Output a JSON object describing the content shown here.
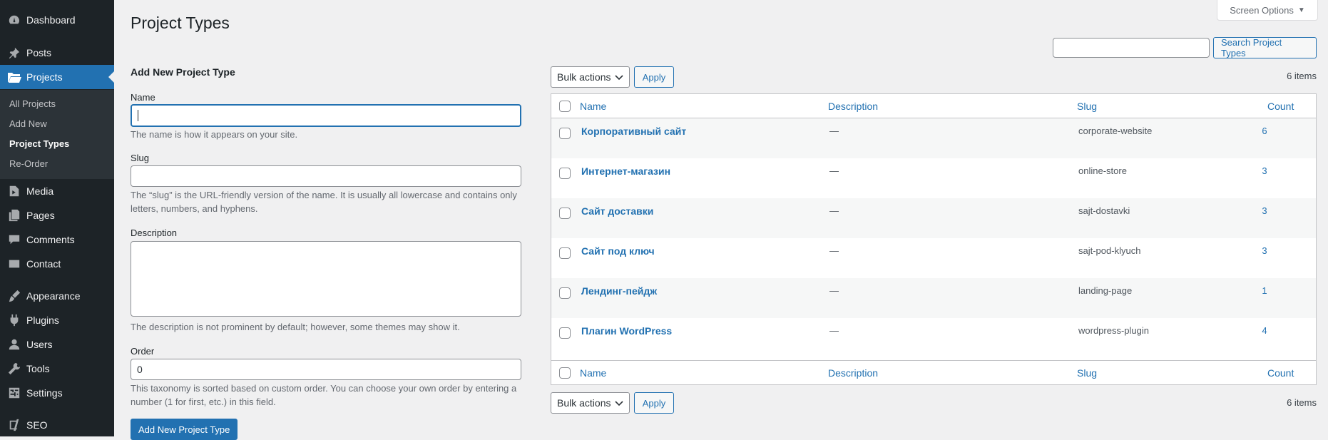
{
  "sidebar": {
    "menu": [
      {
        "label": "Dashboard",
        "icon": "dashboard-icon"
      },
      {
        "label": "Posts",
        "icon": "pin-icon"
      },
      {
        "label": "Projects",
        "icon": "folder-icon"
      },
      {
        "label": "Media",
        "icon": "media-icon"
      },
      {
        "label": "Pages",
        "icon": "pages-icon"
      },
      {
        "label": "Comments",
        "icon": "comment-icon"
      },
      {
        "label": "Contact",
        "icon": "mail-icon"
      },
      {
        "label": "Appearance",
        "icon": "brush-icon"
      },
      {
        "label": "Plugins",
        "icon": "plugin-icon"
      },
      {
        "label": "Users",
        "icon": "user-icon"
      },
      {
        "label": "Tools",
        "icon": "wrench-icon"
      },
      {
        "label": "Settings",
        "icon": "settings-icon"
      },
      {
        "label": "SEO",
        "icon": "seo-icon"
      }
    ],
    "submenu": [
      "All Projects",
      "Add New",
      "Project Types",
      "Re-Order"
    ]
  },
  "header": {
    "title": "Project Types",
    "screen_options": "Screen Options",
    "search_button": "Search Project Types",
    "search_value": ""
  },
  "form": {
    "heading": "Add New Project Type",
    "name_label": "Name",
    "name_value": "",
    "name_desc": "The name is how it appears on your site.",
    "slug_label": "Slug",
    "slug_value": "",
    "slug_desc_1": "The “slug” is the URL-friendly version of the name. It is usually all lowercase and contains only",
    "slug_desc_2": "letters, numbers, and hyphens.",
    "description_label": "Description",
    "description_value": "",
    "description_desc": "The description is not prominent by default; however, some themes may show it.",
    "order_label": "Order",
    "order_value": "0",
    "order_desc_1": "This taxonomy is sorted based on custom order. You can choose your own order by entering a",
    "order_desc_2": "number (1 for first, etc.) in this field.",
    "submit": "Add New Project Type"
  },
  "table": {
    "bulk_actions": "Bulk actions",
    "apply": "Apply",
    "items_count": "6 items",
    "columns": {
      "name": "Name",
      "description": "Description",
      "slug": "Slug",
      "count": "Count"
    },
    "rows": [
      {
        "name": "Корпоративный сайт",
        "description": "—",
        "slug": "corporate-website",
        "count": "6"
      },
      {
        "name": "Интернет-магазин",
        "description": "—",
        "slug": "online-store",
        "count": "3"
      },
      {
        "name": "Сайт доставки",
        "description": "—",
        "slug": "sajt-dostavki",
        "count": "3"
      },
      {
        "name": "Сайт под ключ",
        "description": "—",
        "slug": "sajt-pod-klyuch",
        "count": "3"
      },
      {
        "name": "Лендинг-пейдж",
        "description": "—",
        "slug": "landing-page",
        "count": "1"
      },
      {
        "name": "Плагин WordPress",
        "description": "—",
        "slug": "wordpress-plugin",
        "count": "4"
      }
    ]
  }
}
